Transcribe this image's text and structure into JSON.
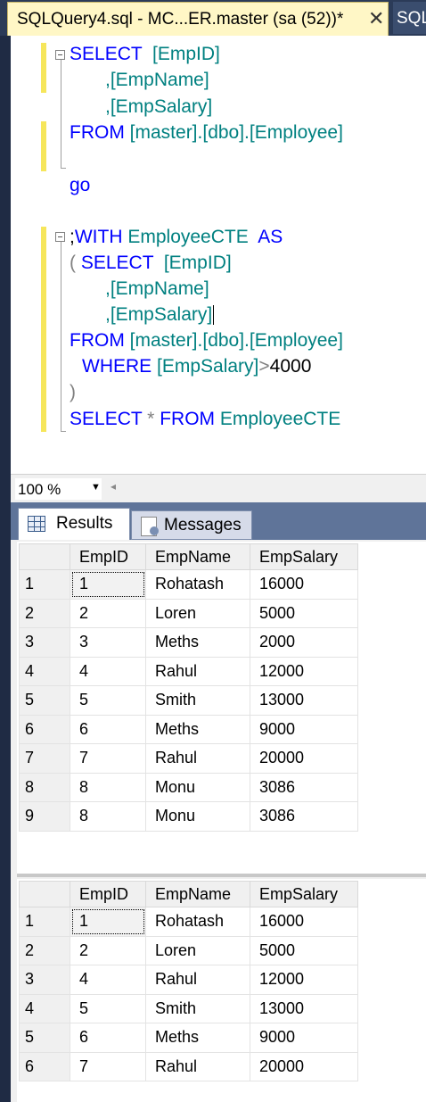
{
  "tabs": {
    "active_title": "SQLQuery4.sql - MC...ER.master (sa (52))*",
    "close_glyph": "✕",
    "next_title": "SQLQuery"
  },
  "editor": {
    "q1": {
      "select": "SELECT",
      "col1": "[EmpID]",
      "col2": ",[EmpName]",
      "col3": ",[EmpSalary]",
      "from": "FROM",
      "table": "[master].[dbo].[Employee]"
    },
    "go": "go",
    "q2": {
      "semi": ";",
      "with": "WITH",
      "cte": "EmployeeCTE",
      "as": "AS",
      "open": "(",
      "select": "SELECT",
      "col1": "[EmpID]",
      "col2": ",[EmpName]",
      "col3": ",[EmpSalary]",
      "from": "FROM",
      "table": "[master].[dbo].[Employee]",
      "where": "WHERE",
      "cond_col": "[EmpSalary]",
      "op": ">",
      "value": "4000",
      "close": ")",
      "final_select": "SELECT",
      "star": "*",
      "final_from": "FROM",
      "final_cte": "EmployeeCTE"
    }
  },
  "status": {
    "zoom": "100 %",
    "dropdown_glyph": "▼",
    "scroll_glyph": "◂"
  },
  "result_tabs": {
    "results": "Results",
    "messages": "Messages"
  },
  "grid1": {
    "columns": [
      "EmpID",
      "EmpName",
      "EmpSalary"
    ],
    "rows": [
      {
        "n": "1",
        "id": "1",
        "name": "Rohatash",
        "salary": "16000"
      },
      {
        "n": "2",
        "id": "2",
        "name": "Loren",
        "salary": "5000"
      },
      {
        "n": "3",
        "id": "3",
        "name": "Meths",
        "salary": "2000"
      },
      {
        "n": "4",
        "id": "4",
        "name": "Rahul",
        "salary": "12000"
      },
      {
        "n": "5",
        "id": "5",
        "name": "Smith",
        "salary": "13000"
      },
      {
        "n": "6",
        "id": "6",
        "name": "Meths",
        "salary": "9000"
      },
      {
        "n": "7",
        "id": "7",
        "name": "Rahul",
        "salary": "20000"
      },
      {
        "n": "8",
        "id": "8",
        "name": "Monu",
        "salary": "3086"
      },
      {
        "n": "9",
        "id": "8",
        "name": "Monu",
        "salary": "3086"
      }
    ]
  },
  "grid2": {
    "columns": [
      "EmpID",
      "EmpName",
      "EmpSalary"
    ],
    "rows": [
      {
        "n": "1",
        "id": "1",
        "name": "Rohatash",
        "salary": "16000"
      },
      {
        "n": "2",
        "id": "2",
        "name": "Loren",
        "salary": "5000"
      },
      {
        "n": "3",
        "id": "4",
        "name": "Rahul",
        "salary": "12000"
      },
      {
        "n": "4",
        "id": "5",
        "name": "Smith",
        "salary": "13000"
      },
      {
        "n": "5",
        "id": "6",
        "name": "Meths",
        "salary": "9000"
      },
      {
        "n": "6",
        "id": "7",
        "name": "Rahul",
        "salary": "20000"
      }
    ]
  }
}
